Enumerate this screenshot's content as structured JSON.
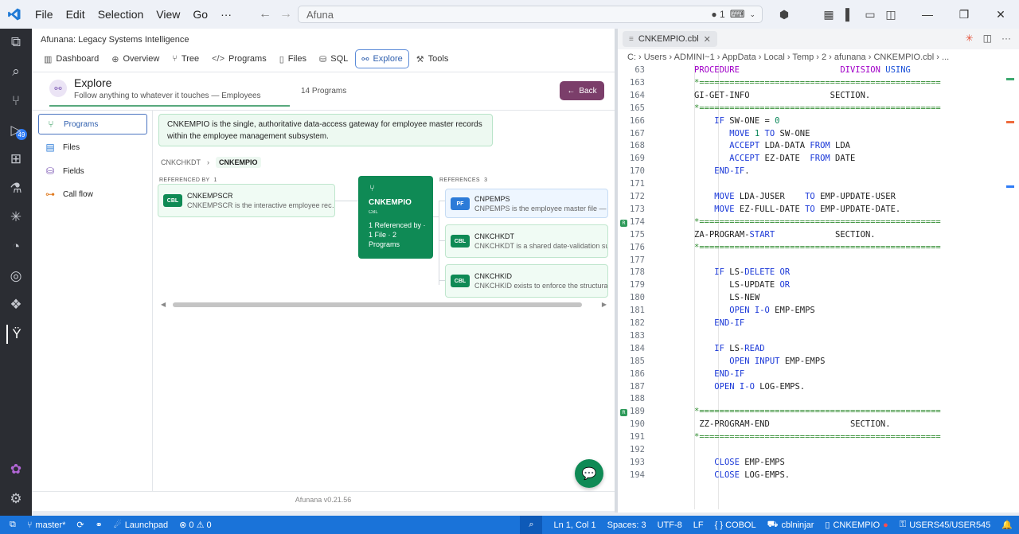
{
  "titlebar": {
    "menus": [
      "File",
      "Edit",
      "Selection",
      "View",
      "Go",
      "···"
    ],
    "search_text": "Afuna",
    "indicator": "● 1"
  },
  "app": {
    "title": "Afunana: Legacy Systems Intelligence",
    "tabs": [
      {
        "label": "Dashboard",
        "icon": "chart-icon"
      },
      {
        "label": "Overview",
        "icon": "globe-icon"
      },
      {
        "label": "Tree",
        "icon": "branch-icon"
      },
      {
        "label": "Programs",
        "icon": "code-icon"
      },
      {
        "label": "Files",
        "icon": "file-icon"
      },
      {
        "label": "SQL",
        "icon": "database-icon"
      },
      {
        "label": "Explore",
        "icon": "explore-icon"
      },
      {
        "label": "Tools",
        "icon": "wrench-icon"
      }
    ],
    "active_tab": "Explore",
    "explore": {
      "title": "Explore",
      "subtitle": "Follow anything to whatever it touches — Employees",
      "count": "14 Programs",
      "back_label": "Back"
    },
    "sidenav": [
      "Programs",
      "Files",
      "Fields",
      "Call flow"
    ],
    "description": "CNKEMPIO is the single, authoritative data-access gateway for employee master records within the employee management subsystem.",
    "breadcrumb": [
      "CNKCHKDT",
      "CNKEMPIO"
    ],
    "referenced_by_label": "REFERENCED BY",
    "referenced_by_count": "1",
    "references_label": "REFERENCES",
    "references_count": "3",
    "referenced_by": [
      {
        "badge": "CBL",
        "name": "CNKEMPSCR",
        "desc": "CNKEMPSCR is the interactive employee rec…"
      }
    ],
    "center": {
      "name": "CNKEMPIO",
      "type": "CBL",
      "stats": "1 Referenced by · 1 File · 2 Programs"
    },
    "references": [
      {
        "badge": "PF",
        "name": "CNPEMPS",
        "desc": "CNPEMPS is the employee master file — the"
      },
      {
        "badge": "CBL",
        "name": "CNKCHKDT",
        "desc": "CNKCHKDT is a shared date-validation subp"
      },
      {
        "badge": "CBL",
        "name": "CNKCHKID",
        "desc": "CNKCHKID exists to enforce the structural in"
      }
    ],
    "version": "Afunana v0.21.56"
  },
  "editor": {
    "tab": "CNKEMPIO.cbl",
    "breadcrumb": "C:  ›  Users  ›  ADMINI~1  ›  AppData  ›  Local  ›  Temp  ›  2  ›  afunana  ›  CNKEMPIO.cbl  ›  ...",
    "lines": [
      {
        "n": "63",
        "t": "PROCEDURE                    DIVISION USING"
      },
      {
        "n": "163",
        "t": "*================================================"
      },
      {
        "n": "164",
        "t": "GI-GET-INFO                SECTION."
      },
      {
        "n": "165",
        "t": "*================================================"
      },
      {
        "n": "166",
        "t": "    IF SW-ONE = 0"
      },
      {
        "n": "167",
        "t": "       MOVE 1 TO SW-ONE"
      },
      {
        "n": "168",
        "t": "       ACCEPT LDA-DATA FROM LDA"
      },
      {
        "n": "169",
        "t": "       ACCEPT EZ-DATE  FROM DATE"
      },
      {
        "n": "170",
        "t": "    END-IF."
      },
      {
        "n": "171",
        "t": ""
      },
      {
        "n": "172",
        "t": "    MOVE LDA-JUSER    TO EMP-UPDATE-USER"
      },
      {
        "n": "173",
        "t": "    MOVE EZ-FULL-DATE TO EMP-UPDATE-DATE."
      },
      {
        "n": "174",
        "t": "*================================================"
      },
      {
        "n": "175",
        "t": "ZA-PROGRAM-START            SECTION."
      },
      {
        "n": "176",
        "t": "*================================================"
      },
      {
        "n": "177",
        "t": ""
      },
      {
        "n": "178",
        "t": "    IF LS-DELETE OR"
      },
      {
        "n": "179",
        "t": "       LS-UPDATE OR"
      },
      {
        "n": "180",
        "t": "       LS-NEW"
      },
      {
        "n": "181",
        "t": "       OPEN I-O EMP-EMPS"
      },
      {
        "n": "182",
        "t": "    END-IF"
      },
      {
        "n": "183",
        "t": ""
      },
      {
        "n": "184",
        "t": "    IF LS-READ"
      },
      {
        "n": "185",
        "t": "       OPEN INPUT EMP-EMPS"
      },
      {
        "n": "186",
        "t": "    END-IF"
      },
      {
        "n": "187",
        "t": "    OPEN I-O LOG-EMPS."
      },
      {
        "n": "188",
        "t": ""
      },
      {
        "n": "189",
        "t": "*================================================"
      },
      {
        "n": "190",
        "t": " ZZ-PROGRAM-END                SECTION."
      },
      {
        "n": "191",
        "t": "*================================================"
      },
      {
        "n": "192",
        "t": ""
      },
      {
        "n": "193",
        "t": "    CLOSE EMP-EMPS"
      },
      {
        "n": "194",
        "t": "    CLOSE LOG-EMPS."
      }
    ]
  },
  "statusbar": {
    "branch": "master*",
    "launchpad": "Launchpad",
    "problems": "⊗ 0 ⚠ 0",
    "position": "Ln 1, Col 1",
    "spaces": "Spaces: 3",
    "encoding": "UTF-8",
    "eol": "LF",
    "language": "{ } COBOL",
    "cblninjar": "cblninjar",
    "file": "CNKEMPIO",
    "user": "USERS45/USER545"
  },
  "colors": {
    "accent_green": "#0f8a55",
    "status_blue": "#1a73d9",
    "back_purple": "#7b3e6a",
    "keyword_blue": "#0000ff",
    "cobol_purple": "#a000c8"
  }
}
